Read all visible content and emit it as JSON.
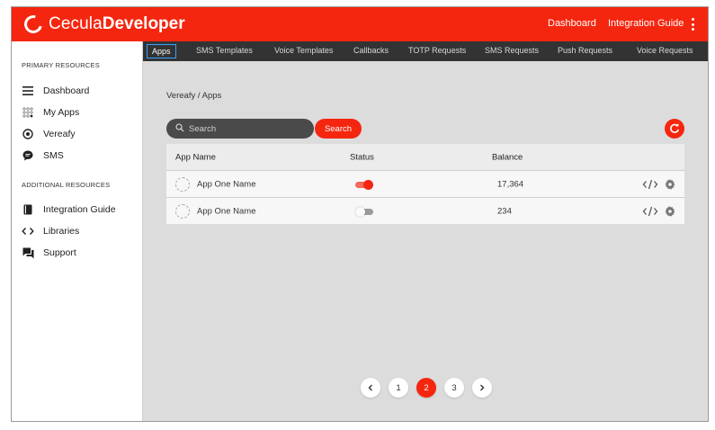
{
  "brand": {
    "name_light": "Cecula",
    "name_bold": "Developer",
    "color": "#f5260f"
  },
  "topnav": {
    "dashboard": "Dashboard",
    "integration_guide": "Integration Guide"
  },
  "sidebar": {
    "primary_heading": "PRIMARY RESOURCES",
    "primary_items": [
      {
        "label": "Dashboard",
        "icon": "menu-icon"
      },
      {
        "label": "My Apps",
        "icon": "apps-grid-icon"
      },
      {
        "label": "Vereafy",
        "icon": "target-icon"
      },
      {
        "label": "SMS",
        "icon": "chat-icon"
      }
    ],
    "additional_heading": "ADDITIONAL RESOURCES",
    "additional_items": [
      {
        "label": "Integration Guide",
        "icon": "book-icon"
      },
      {
        "label": "Libraries",
        "icon": "code-icon"
      },
      {
        "label": "Support",
        "icon": "forum-icon"
      }
    ]
  },
  "tabs": [
    "Apps",
    "SMS Templates",
    "Voice Templates",
    "Callbacks",
    "TOTP Requests",
    "SMS Requests",
    "Push Requests",
    "Voice Requests"
  ],
  "breadcrumb": "Vereafy / Apps",
  "search": {
    "placeholder": "Search",
    "button": "Search"
  },
  "table": {
    "headers": {
      "name": "App Name",
      "status": "Status",
      "balance": "Balance"
    },
    "rows": [
      {
        "name": "App One Name",
        "status_on": true,
        "balance": "17,364"
      },
      {
        "name": "App One Name",
        "status_on": false,
        "balance": "234"
      }
    ]
  },
  "pagination": {
    "pages": [
      "1",
      "2",
      "3"
    ],
    "current": "2"
  }
}
